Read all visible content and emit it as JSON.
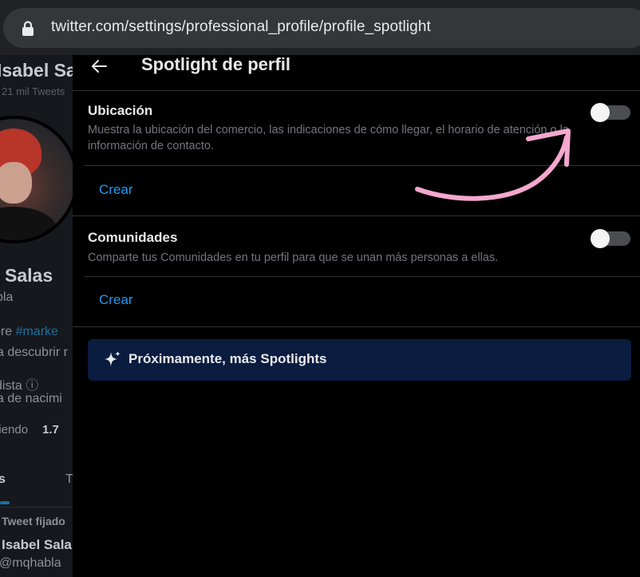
{
  "browser": {
    "url": "twitter.com/settings/professional_profile/profile_spotlight",
    "lock_icon": "lock-icon"
  },
  "background_profile": {
    "name": "Isabel Sa",
    "tweet_count": "21 mil Tweets",
    "full_name": "Salas",
    "handle": "bla",
    "bio_line1_prefix": "bre ",
    "bio_line1_hashtag": "#marke",
    "bio_line2": "a descubrir r",
    "meta_line1": "dista",
    "meta_line2": "a de nacimi",
    "following_label": "uiendo",
    "following_value": "1.7",
    "tab1": "s",
    "tab2": "T",
    "pinned_label": "Tweet fijado",
    "pinned_name": "Isabel Sala",
    "pinned_handle": "@mqhabla"
  },
  "modal": {
    "title": "Spotlight de perfil",
    "back_icon": "back-arrow-icon",
    "sections": [
      {
        "title": "Ubicación",
        "description": "Muestra la ubicación del comercio, las indicaciones de cómo llegar, el horario de atención o la información de contacto.",
        "toggle_on": false,
        "action_label": "Crear"
      },
      {
        "title": "Comunidades",
        "description": "Comparte tus Comunidades en tu perfil para que se unan más personas a ellas.",
        "toggle_on": false,
        "action_label": "Crear"
      }
    ],
    "promo": {
      "icon": "sparkle-icon",
      "text": "Próximamente, más Spotlights"
    }
  },
  "colors": {
    "accent": "#1d9bf0",
    "promo_bg": "#0a1c40",
    "annotation_arrow": "#f4a7cf"
  }
}
